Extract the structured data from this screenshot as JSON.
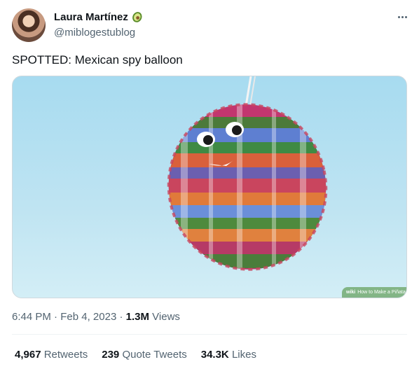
{
  "author": {
    "display_name": "Laura Martínez",
    "badge_emoji": "avocado-icon",
    "handle": "@miblogestublog"
  },
  "tweet": {
    "text": "SPOTTED: Mexican spy balloon",
    "media_watermark": {
      "brand": "wiki",
      "text": "How to Make a Piñata"
    },
    "time": "6:44 PM",
    "separator": "·",
    "date": "Feb 4, 2023",
    "views_count": "1.3M",
    "views_label": "Views"
  },
  "stats": {
    "retweets_count": "4,967",
    "retweets_label": "Retweets",
    "quotes_count": "239",
    "quotes_label": "Quote Tweets",
    "likes_count": "34.3K",
    "likes_label": "Likes"
  },
  "colors": {
    "text_primary": "#0f1419",
    "text_secondary": "#536471",
    "border": "#cfd9de"
  }
}
